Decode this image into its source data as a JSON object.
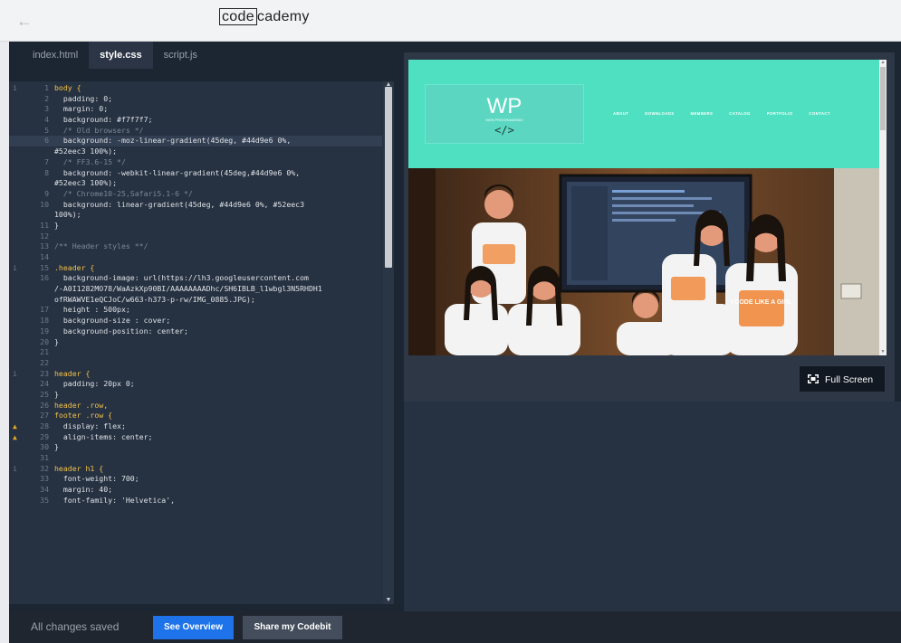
{
  "brand": {
    "left": "code",
    "right": "cademy"
  },
  "tabs": [
    {
      "label": "index.html",
      "active": false
    },
    {
      "label": "style.css",
      "active": true
    },
    {
      "label": "script.js",
      "active": false
    }
  ],
  "editor": {
    "lines": [
      {
        "n": "1",
        "t": "body {"
      },
      {
        "n": "2",
        "t": "  padding: 0;"
      },
      {
        "n": "3",
        "t": "  margin: 0;"
      },
      {
        "n": "4",
        "t": "  background: #f7f7f7;"
      },
      {
        "n": "5",
        "t": "  /* Old browsers */"
      },
      {
        "n": "6",
        "t": "  background: -moz-linear-gradient(45deg, #44d9e6 0%,"
      },
      {
        "n": "",
        "t": "#52eec3 100%);"
      },
      {
        "n": "7",
        "t": "  /* FF3.6-15 */"
      },
      {
        "n": "8",
        "t": "  background: -webkit-linear-gradient(45deg,#44d9e6 0%,"
      },
      {
        "n": "",
        "t": "#52eec3 100%);"
      },
      {
        "n": "9",
        "t": "  /* Chrome10-25,Safari5.1-6 */"
      },
      {
        "n": "10",
        "t": "  background: linear-gradient(45deg, #44d9e6 0%, #52eec3"
      },
      {
        "n": "",
        "t": "100%);"
      },
      {
        "n": "11",
        "t": "}"
      },
      {
        "n": "12",
        "t": ""
      },
      {
        "n": "13",
        "t": "/** Header styles **/"
      },
      {
        "n": "14",
        "t": ""
      },
      {
        "n": "15",
        "t": ".header {"
      },
      {
        "n": "16",
        "t": "  background-image: url(https://lh3.googleusercontent.com"
      },
      {
        "n": "",
        "t": "/-A0I1282MO78/WaAzkXp90BI/AAAAAAAADhc/SH6IBLB_l1wbgl3N5RHDH1"
      },
      {
        "n": "",
        "t": "ofRWAWVE1eQCJoC/w663-h373-p-rw/IMG_0885.JPG);"
      },
      {
        "n": "17",
        "t": "  height : 500px;"
      },
      {
        "n": "18",
        "t": "  background-size : cover;"
      },
      {
        "n": "19",
        "t": "  background-position: center;"
      },
      {
        "n": "20",
        "t": "}"
      },
      {
        "n": "21",
        "t": ""
      },
      {
        "n": "22",
        "t": ""
      },
      {
        "n": "23",
        "t": "header {"
      },
      {
        "n": "24",
        "t": "  padding: 20px 0;"
      },
      {
        "n": "25",
        "t": "}"
      },
      {
        "n": "26",
        "t": "header .row,"
      },
      {
        "n": "27",
        "t": "footer .row {"
      },
      {
        "n": "28",
        "t": "  display: flex;"
      },
      {
        "n": "29",
        "t": "  align-items: center;"
      },
      {
        "n": "30",
        "t": "}"
      },
      {
        "n": "31",
        "t": ""
      },
      {
        "n": "32",
        "t": "header h1 {"
      },
      {
        "n": "33",
        "t": "  font-weight: 700;"
      },
      {
        "n": "34",
        "t": "  margin: 40;"
      },
      {
        "n": "35",
        "t": "  font-family: 'Helvetica',"
      }
    ]
  },
  "preview": {
    "logo": "WP",
    "logo_sub": "WEB PROGRAMMING",
    "logo_code": "</>",
    "nav": [
      "ABOUT",
      "DOWNLOADS",
      "MEMBERS",
      "CATALOG",
      "PORTFOLIO",
      "CONTACT"
    ],
    "tshirt_text": "I CODE LIKE A GIRL"
  },
  "fullscreen_label": "Full Screen",
  "footer": {
    "status": "All changes saved",
    "overview_label": "See Overview",
    "share_label": "Share my Codebit"
  },
  "colors": {
    "accent": "#1e73ea",
    "preview_header": "#4fe0c1",
    "editor_bg": "#263141"
  }
}
